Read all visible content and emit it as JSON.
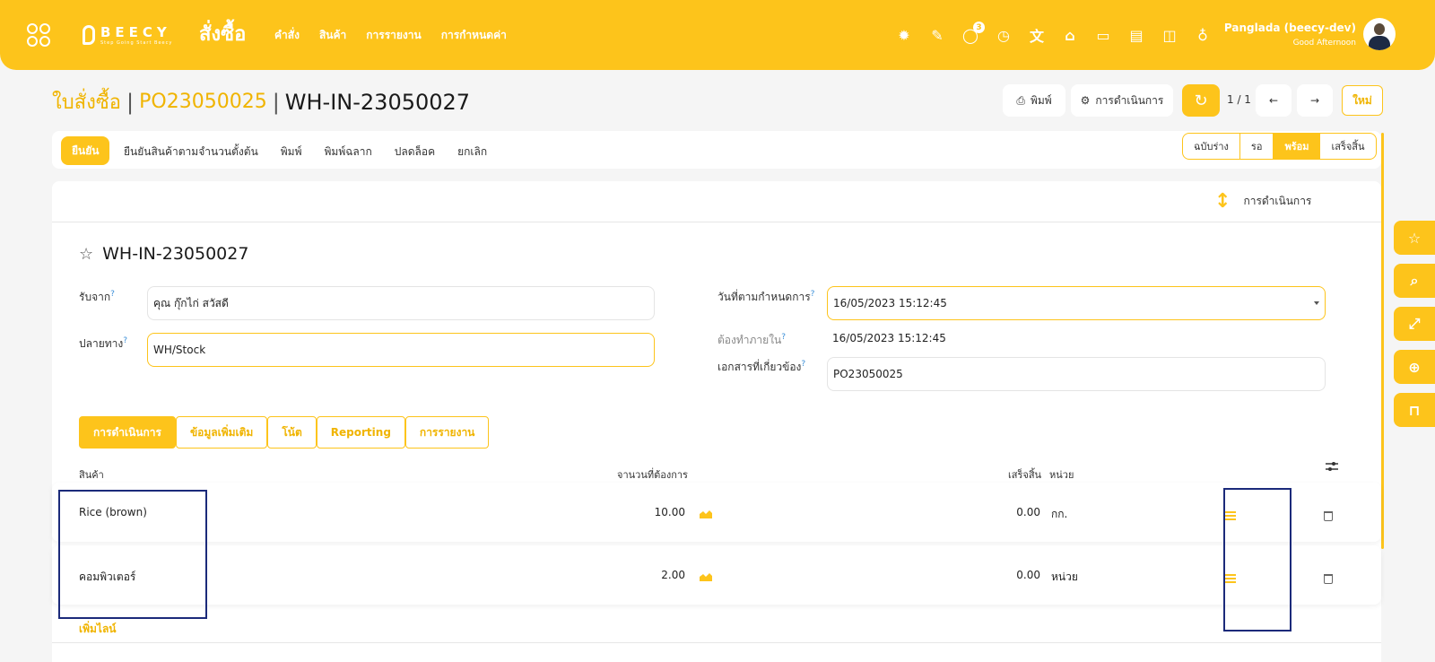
{
  "header": {
    "logo_text": "BEECY",
    "logo_sub": "Step Going Start Beecy",
    "app_title": "สั่งซื้อ",
    "nav": [
      "คำสั่ง",
      "สินค้า",
      "การรายงาน",
      "การกำหนดค่า"
    ],
    "chat_badge": "3",
    "user_name": "Panglada (beecy-dev)",
    "greeting": "Good Afternoon"
  },
  "breadcrumb": {
    "root": "ใบสั่งซื้อ",
    "parent": "PO23050025",
    "current": "WH-IN-23050027"
  },
  "control": {
    "print_label": "พิมพ์",
    "action_label": "การดำเนินการ",
    "pager": "1 / 1",
    "new_label": "ใหม่"
  },
  "actions": {
    "confirm": "ยืนยัน",
    "items": [
      "ยืนยันสินค้าตามจำนวนตั้งต้น",
      "พิมพ์",
      "พิมพ์ฉลาก",
      "ปลดล็อค",
      "ยกเลิก"
    ],
    "statuses": [
      "ฉบับร่าง",
      "รอ",
      "พร้อม",
      "เสร็จสิ้น"
    ],
    "active_status": "พร้อม"
  },
  "chatter": {
    "label": "การดำเนินการ"
  },
  "record": {
    "title": "WH-IN-23050027",
    "receive_from_label": "รับจาก",
    "receive_from": "คุณ กุ๊กไก่ สวัสดี",
    "destination_label": "ปลายทาง",
    "destination": "WH/Stock",
    "scheduled_label": "วันที่ตามกำหนดการ",
    "scheduled": "16/05/2023 15:12:45",
    "deadline_label": "ต้องทำภายใน",
    "deadline": "16/05/2023 15:12:45",
    "source_doc_label": "เอกสารที่เกี่ยวข้อง",
    "source_doc": "PO23050025"
  },
  "tabs": [
    "การดำเนินการ",
    "ข้อมูลเพิ่มเติม",
    "โน้ต",
    "Reporting",
    "การรายงาน"
  ],
  "table": {
    "headers": {
      "product": "สินค้า",
      "demand": "จานวนที่ต้องการ",
      "done": "เสร็จสิ้น",
      "unit": "หน่วย"
    },
    "rows": [
      {
        "product": "Rice (brown)",
        "demand": "10.00",
        "done": "0.00",
        "unit": "กก."
      },
      {
        "product": "คอมพิวเตอร์",
        "demand": "2.00",
        "done": "0.00",
        "unit": "หน่วย"
      }
    ],
    "add_line": "เพิ่มไลน์"
  },
  "colors": {
    "accent": "#fdc41b",
    "highlight": "#1b2a7a"
  }
}
